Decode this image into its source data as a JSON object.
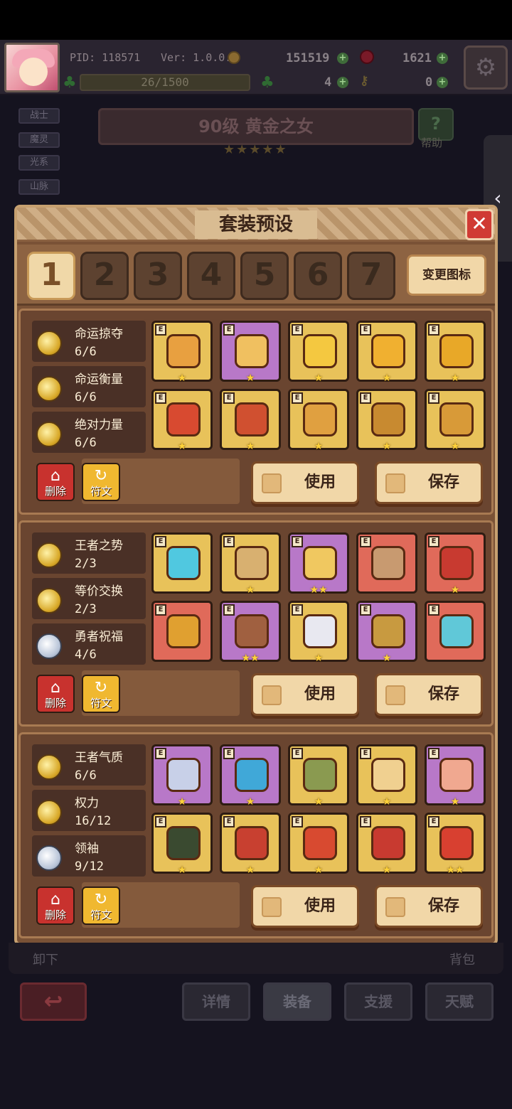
{
  "hud": {
    "pid": "PID: 118571",
    "version": "Ver: 1.0.0.3",
    "gold": "151519",
    "gems": "1621",
    "xp": "26/1500",
    "clover": "4",
    "keys": "0"
  },
  "side_tags": [
    "战士",
    "魔灵",
    "光系",
    "山脉"
  ],
  "hero": {
    "title": "90级  黄金之女",
    "stars": "★★★★★",
    "help_label": "帮助"
  },
  "dialog": {
    "title": "套装预设",
    "close": "✕",
    "tabs": [
      "1",
      "2",
      "3",
      "4",
      "5",
      "6",
      "7"
    ],
    "active_tab": "1",
    "change_icon": "变更图标",
    "delete_label": "删除",
    "rune_label": "符文",
    "use_label": "使用",
    "save_label": "保存",
    "tier_mark": "E",
    "presets": [
      {
        "sets": [
          {
            "name": "命运掠夺",
            "count": "6/6",
            "medal": "gold"
          },
          {
            "name": "命运衡量",
            "count": "6/6",
            "medal": "gold"
          },
          {
            "name": "绝对力量",
            "count": "6/6",
            "medal": "gold"
          }
        ],
        "slots": [
          {
            "bg": "gold",
            "item": "staff-icon",
            "color": "#e8a040",
            "stars": "★"
          },
          {
            "bg": "purple",
            "item": "amulet-icon",
            "color": "#f0c060",
            "stars": "★"
          },
          {
            "bg": "gold",
            "item": "necklace-icon",
            "color": "#f4c840",
            "stars": "★"
          },
          {
            "bg": "gold",
            "item": "gem-icon",
            "color": "#f0b030",
            "stars": "★"
          },
          {
            "bg": "gold",
            "item": "ring-icon",
            "color": "#e8a828",
            "stars": "★"
          },
          {
            "bg": "gold",
            "item": "helmet-icon",
            "color": "#d84a30",
            "stars": "★"
          },
          {
            "bg": "gold",
            "item": "armor-icon",
            "color": "#d05030",
            "stars": "★"
          },
          {
            "bg": "gold",
            "item": "gauntlet-icon",
            "color": "#e0a040",
            "stars": "★"
          },
          {
            "bg": "gold",
            "item": "belt-icon",
            "color": "#c88a30",
            "stars": "★"
          },
          {
            "bg": "gold",
            "item": "boots-icon",
            "color": "#d89a38",
            "stars": "★"
          }
        ]
      },
      {
        "sets": [
          {
            "name": "王者之势",
            "count": "2/3",
            "medal": "gold"
          },
          {
            "name": "等价交换",
            "count": "2/3",
            "medal": "gold"
          },
          {
            "name": "勇者祝福",
            "count": "4/6",
            "medal": "silver"
          }
        ],
        "slots": [
          {
            "bg": "gold",
            "item": "key-icon",
            "color": "#50c8e0",
            "stars": ""
          },
          {
            "bg": "gold",
            "item": "shield-icon",
            "color": "#d8b070",
            "stars": "★"
          },
          {
            "bg": "purple",
            "item": "necklace-icon",
            "color": "#f0c860",
            "stars": "★★"
          },
          {
            "bg": "red",
            "item": "shell-icon",
            "color": "#c89a70",
            "stars": ""
          },
          {
            "bg": "red",
            "item": "ring-icon",
            "color": "#c83a30",
            "stars": "★"
          },
          {
            "bg": "red",
            "item": "hat-icon",
            "color": "#e0a030",
            "stars": ""
          },
          {
            "bg": "purple",
            "item": "armor-icon",
            "color": "#a06040",
            "stars": "★★"
          },
          {
            "bg": "gold",
            "item": "gauntlet-icon",
            "color": "#e8e8f0",
            "stars": "★"
          },
          {
            "bg": "purple",
            "item": "belt-icon",
            "color": "#c89a40",
            "stars": "★"
          },
          {
            "bg": "red",
            "item": "boots-icon",
            "color": "#60c8d8",
            "stars": ""
          }
        ]
      },
      {
        "sets": [
          {
            "name": "王者气质",
            "count": "6/6",
            "medal": "gold"
          },
          {
            "name": "权力",
            "count": "16/12",
            "medal": "gold"
          },
          {
            "name": "领袖",
            "count": "9/12",
            "medal": "silver"
          }
        ],
        "slots": [
          {
            "bg": "purple",
            "item": "sword-icon",
            "color": "#c8d0e8",
            "stars": "★"
          },
          {
            "bg": "purple",
            "item": "dagger-icon",
            "color": "#40a8d8",
            "stars": "★"
          },
          {
            "bg": "gold",
            "item": "necklace-icon",
            "color": "#8a9a50",
            "stars": "★"
          },
          {
            "bg": "gold",
            "item": "shield-icon",
            "color": "#f0d090",
            "stars": "★"
          },
          {
            "bg": "purple",
            "item": "ring-icon",
            "color": "#f0a890",
            "stars": "★"
          },
          {
            "bg": "gold",
            "item": "hood-icon",
            "color": "#3a4a30",
            "stars": "★"
          },
          {
            "bg": "gold",
            "item": "armor-icon",
            "color": "#c84030",
            "stars": "★"
          },
          {
            "bg": "gold",
            "item": "gauntlet-icon",
            "color": "#d84a30",
            "stars": "★"
          },
          {
            "bg": "gold",
            "item": "belt-icon",
            "color": "#c83a30",
            "stars": "★"
          },
          {
            "bg": "gold",
            "item": "boots-icon",
            "color": "#d84030",
            "stars": "★★"
          }
        ]
      }
    ]
  },
  "bottom": {
    "unequip": "卸下",
    "bag": "背包",
    "back": "↩",
    "nav": [
      "详情",
      "装备",
      "支援",
      "天赋"
    ],
    "active_nav": "装备"
  }
}
